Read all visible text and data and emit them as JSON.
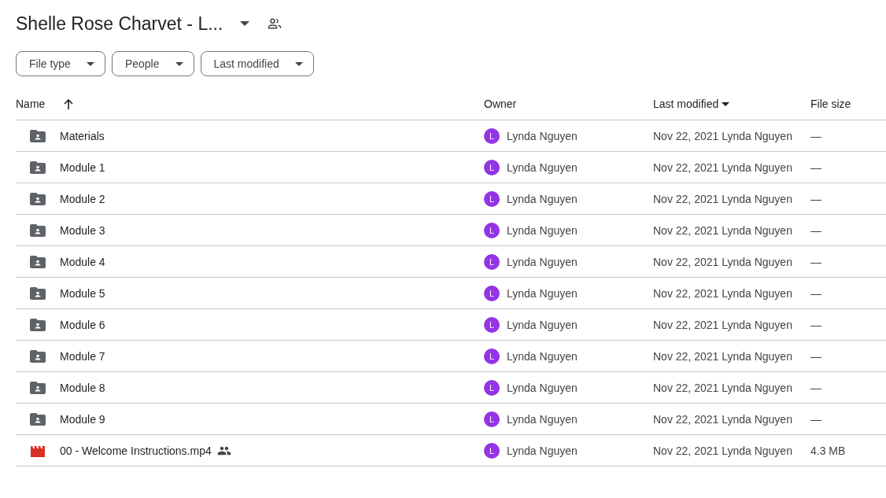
{
  "title": "Shelle Rose Charvet - L...",
  "filters": [
    "File type",
    "People",
    "Last modified"
  ],
  "columns": [
    "Name",
    "Owner",
    "Last modified",
    "File size"
  ],
  "rows": [
    {
      "kind": "folder",
      "name": "Materials",
      "shared": false,
      "avatar": "L",
      "owner": "Lynda Nguyen",
      "modified": "Nov 22, 2021 Lynda Nguyen",
      "size": "—"
    },
    {
      "kind": "folder",
      "name": "Module 1",
      "shared": false,
      "avatar": "L",
      "owner": "Lynda Nguyen",
      "modified": "Nov 22, 2021 Lynda Nguyen",
      "size": "—"
    },
    {
      "kind": "folder",
      "name": "Module 2",
      "shared": false,
      "avatar": "L",
      "owner": "Lynda Nguyen",
      "modified": "Nov 22, 2021 Lynda Nguyen",
      "size": "—"
    },
    {
      "kind": "folder",
      "name": "Module 3",
      "shared": false,
      "avatar": "L",
      "owner": "Lynda Nguyen",
      "modified": "Nov 22, 2021 Lynda Nguyen",
      "size": "—"
    },
    {
      "kind": "folder",
      "name": "Module 4",
      "shared": false,
      "avatar": "L",
      "owner": "Lynda Nguyen",
      "modified": "Nov 22, 2021 Lynda Nguyen",
      "size": "—"
    },
    {
      "kind": "folder",
      "name": "Module 5",
      "shared": false,
      "avatar": "L",
      "owner": "Lynda Nguyen",
      "modified": "Nov 22, 2021 Lynda Nguyen",
      "size": "—"
    },
    {
      "kind": "folder",
      "name": "Module 6",
      "shared": false,
      "avatar": "L",
      "owner": "Lynda Nguyen",
      "modified": "Nov 22, 2021 Lynda Nguyen",
      "size": "—"
    },
    {
      "kind": "folder",
      "name": "Module 7",
      "shared": false,
      "avatar": "L",
      "owner": "Lynda Nguyen",
      "modified": "Nov 22, 2021 Lynda Nguyen",
      "size": "—"
    },
    {
      "kind": "folder",
      "name": "Module 8",
      "shared": false,
      "avatar": "L",
      "owner": "Lynda Nguyen",
      "modified": "Nov 22, 2021 Lynda Nguyen",
      "size": "—"
    },
    {
      "kind": "folder",
      "name": "Module 9",
      "shared": false,
      "avatar": "L",
      "owner": "Lynda Nguyen",
      "modified": "Nov 22, 2021 Lynda Nguyen",
      "size": "—"
    },
    {
      "kind": "video",
      "name": "00 - Welcome Instructions.mp4",
      "shared": true,
      "avatar": "L",
      "owner": "Lynda Nguyen",
      "modified": "Nov 22, 2021 Lynda Nguyen",
      "size": "4.3 MB"
    }
  ]
}
